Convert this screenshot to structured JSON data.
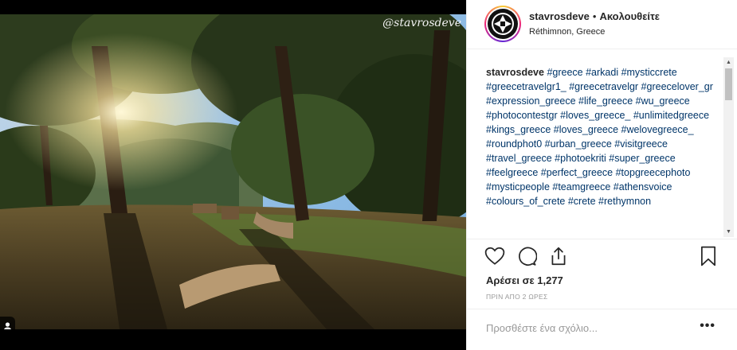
{
  "photo": {
    "watermark": "@stavrosdeve",
    "alt_subject": "forest-sunset-photo"
  },
  "header": {
    "username": "stavrosdeve",
    "separator": "•",
    "follow_status": "Ακολουθείτε",
    "location": "Réthimnon, Greece"
  },
  "caption": {
    "username": "stavrosdeve",
    "hashtags": "#greece #arkadi #mysticcrete #greecetravelgr1_ #greecetravelgr #greecelover_gr #expression_greece #life_greece #wu_greece #photocontestgr #loves_greece_ #unlimitedgreece #kings_greece #loves_greece #welovegreece_ #roundphot0 #urban_greece #visitgreece #travel_greece #photoekriti #super_greece #feelgreece #perfect_greece #topgreecephoto #mysticpeople #teamgreece #athensvoice #colours_of_crete #crete #rethymnon"
  },
  "actions": {
    "likes_text": "Αρέσει σε 1,277",
    "time_text": "ΠΡΙΝ ΑΠΟ 2 ΩΡΕΣ"
  },
  "comment": {
    "placeholder": "Προσθέστε ένα σχόλιο...",
    "more_label": "•••"
  },
  "colors": {
    "hashtag": "#003569",
    "text": "#262626",
    "muted": "#999999",
    "border": "#efefef"
  }
}
